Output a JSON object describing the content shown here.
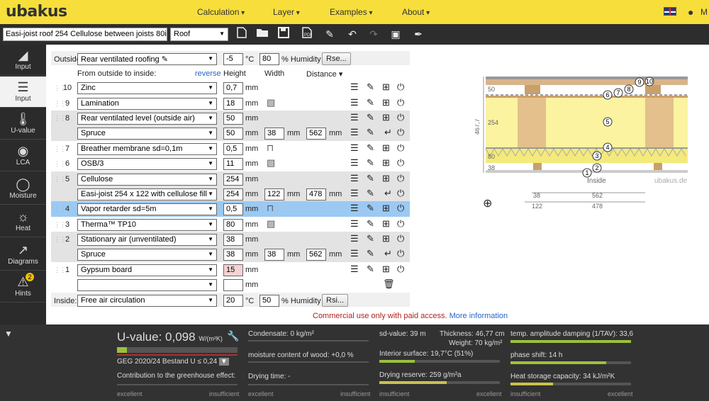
{
  "app": {
    "logo": "ubakus"
  },
  "nav": {
    "calc": "Calculation",
    "layer": "Layer",
    "examples": "Examples",
    "about": "About",
    "user_label": "M"
  },
  "toolbar": {
    "project_name": "Easi-joist roof 254 Cellulose between joists 80i",
    "type": "Roof"
  },
  "sidebar": [
    {
      "label": "Input",
      "icon": "ruler-icon"
    },
    {
      "label": "Input",
      "icon": "layers-icon"
    },
    {
      "label": "U-value",
      "icon": "thermometer-icon"
    },
    {
      "label": "LCA",
      "icon": "globe-icon"
    },
    {
      "label": "Moisture",
      "icon": "drop-icon"
    },
    {
      "label": "Heat",
      "icon": "sun-icon"
    },
    {
      "label": "Diagrams",
      "icon": "chart-icon"
    },
    {
      "label": "Hints",
      "icon": "alert-icon",
      "badge": "2"
    }
  ],
  "outside": {
    "label": "Outside",
    "condition": "Rear ventilated roofing",
    "temp": "-5",
    "temp_unit": "°C",
    "humidity": "80",
    "humidity_unit": "% Humidity",
    "rse_button": "Rse..."
  },
  "headers": {
    "from": "From outside to inside:",
    "reverse": "reverse",
    "height": "Height",
    "width": "Width",
    "distance": "Distance"
  },
  "units": {
    "mm": "mm"
  },
  "layers": [
    {
      "n": "10",
      "name": "Zinc",
      "h": "0,7"
    },
    {
      "n": "9",
      "name": "Lamination",
      "h": "18"
    },
    {
      "n": "8",
      "name": "Rear ventilated level (outside air)",
      "h": "50",
      "sub": {
        "name": "Spruce",
        "h": "50",
        "w": "38",
        "d": "562"
      }
    },
    {
      "n": "7",
      "name": "Breather membrane sd=0,1m",
      "h": "0,5"
    },
    {
      "n": "6",
      "name": "OSB/3",
      "h": "11"
    },
    {
      "n": "5",
      "name": "Cellulose",
      "h": "254",
      "sub": {
        "name": "Easi-joist 254 x 122 with cellulose fill",
        "h": "254",
        "w": "122",
        "d": "478"
      }
    },
    {
      "n": "4",
      "name": "Vapor retarder sd=5m",
      "h": "0,5"
    },
    {
      "n": "3",
      "name": "Therma™ TP10",
      "h": "80"
    },
    {
      "n": "2",
      "name": "Stationary air (unventilated)",
      "h": "38",
      "sub": {
        "name": "Spruce",
        "h": "38",
        "w": "38",
        "d": "562"
      }
    },
    {
      "n": "1",
      "name": "Gypsum board",
      "h": "15"
    }
  ],
  "inside": {
    "label": "Inside:",
    "condition": "Free air circulation",
    "temp": "20",
    "temp_unit": "°C",
    "humidity": "50",
    "humidity_unit": "% Humidity",
    "rsi_button": "Rsi..."
  },
  "notice": {
    "text": "Commercial use only with paid access.",
    "link": "More information"
  },
  "diagram": {
    "dims": [
      "50",
      "254",
      "80",
      "38"
    ],
    "total": "467,7",
    "inside": "Inside",
    "brand": "ubakus.de",
    "bottom_top": [
      "38",
      "562"
    ],
    "bottom_low": [
      "122",
      "478"
    ],
    "callouts": [
      "1",
      "2",
      "3",
      "4",
      "5",
      "6",
      "7",
      "8",
      "9",
      "10"
    ]
  },
  "results": {
    "uvalue_label": "U-value:",
    "uvalue": "0,098",
    "uvalue_unit": "W/(m²K)",
    "uvalue_fill": 0.08,
    "geg": "GEG 2020/24 Bestand U ≤ 0,24",
    "contribution": "Contribution to the greenhouse effect:",
    "condensate": "Condensate: 0 kg/m²",
    "moisture": "moisture content of wood: +0,0 %",
    "drying": "Drying time: -",
    "sdvalue": "sd-value: 39 m",
    "thickness": "Thickness: 46,77 cm",
    "weight": "Weight: 70 kg/m²",
    "surface": "Interior surface: 19,7°C (51%)",
    "reserve": "Drying reserve: 259 g/m²a",
    "tav": "temp. amplitude damping (1/TAV): 33,6",
    "phase": "phase shift: 14 h",
    "heat": "Heat storage capacity: 34 kJ/m²K",
    "excellent": "excellent",
    "insufficient": "insufficient"
  }
}
